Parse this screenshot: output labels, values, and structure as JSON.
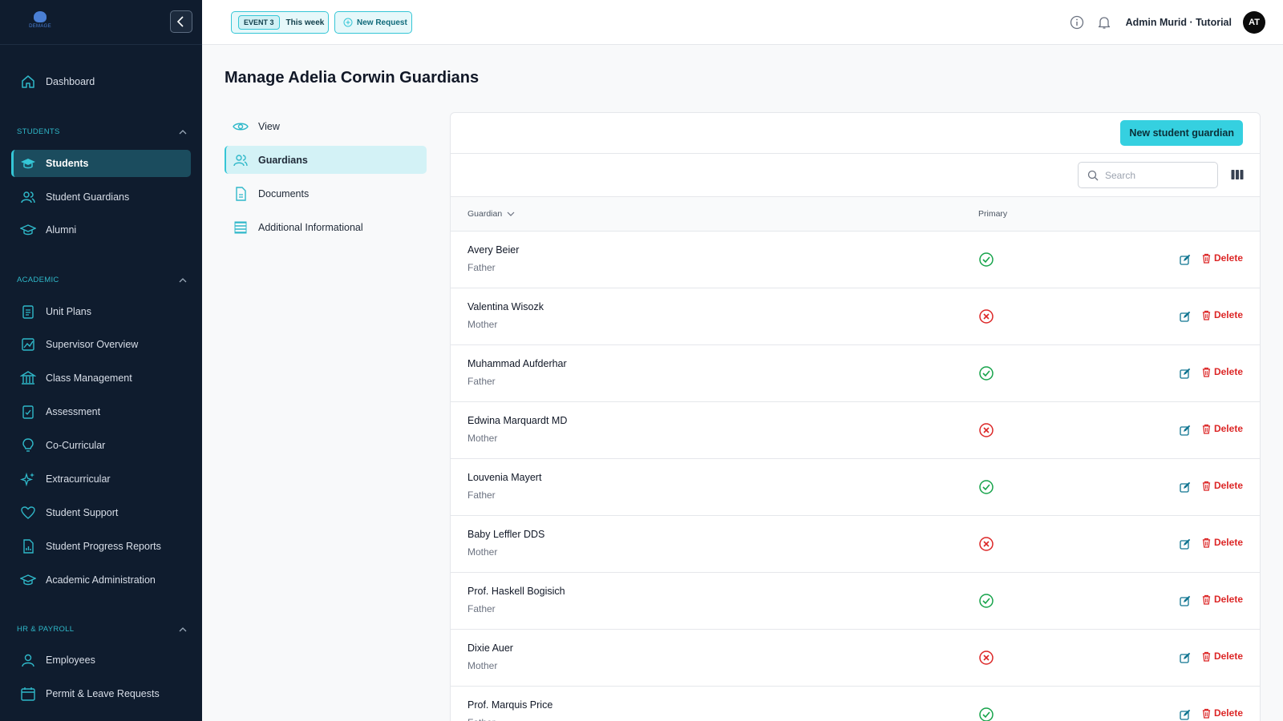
{
  "app": {
    "logo_text": "DEMAGE"
  },
  "sidebar": {
    "items_top": [
      {
        "label": "Dashboard",
        "icon": "home-icon"
      }
    ],
    "sections": [
      {
        "title": "STUDENTS",
        "items": [
          {
            "label": "Students",
            "icon": "graduation-cap-icon",
            "active": true
          },
          {
            "label": "Student Guardians",
            "icon": "users-icon"
          },
          {
            "label": "Alumni",
            "icon": "graduation-cap-icon"
          }
        ]
      },
      {
        "title": "ACADEMIC",
        "items": [
          {
            "label": "Unit Plans",
            "icon": "clipboard-list-icon"
          },
          {
            "label": "Supervisor Overview",
            "icon": "chart-icon"
          },
          {
            "label": "Class Management",
            "icon": "building-icon"
          },
          {
            "label": "Assessment",
            "icon": "clipboard-check-icon"
          },
          {
            "label": "Co-Curricular",
            "icon": "lightbulb-icon"
          },
          {
            "label": "Extracurricular",
            "icon": "sparkles-icon"
          },
          {
            "label": "Student Support",
            "icon": "heart-icon"
          },
          {
            "label": "Student Progress Reports",
            "icon": "report-icon"
          },
          {
            "label": "Academic Administration",
            "icon": "graduation-cap-icon"
          }
        ]
      },
      {
        "title": "HR & PAYROLL",
        "items": [
          {
            "label": "Employees",
            "icon": "user-icon"
          },
          {
            "label": "Permit & Leave Requests",
            "icon": "calendar-icon"
          }
        ]
      }
    ]
  },
  "topbar": {
    "event_badge": "EVENT 3",
    "event_label": "This week",
    "new_request": "New Request",
    "admin_label": "Admin Murid · Tutorial",
    "avatar_initials": "AT"
  },
  "page": {
    "title": "Manage Adelia Corwin Guardians",
    "subnav": [
      {
        "label": "View",
        "icon": "eye-icon"
      },
      {
        "label": "Guardians",
        "icon": "users-icon",
        "active": true
      },
      {
        "label": "Documents",
        "icon": "document-icon"
      },
      {
        "label": "Additional Informational",
        "icon": "list-icon"
      }
    ]
  },
  "table": {
    "new_button": "New student guardian",
    "search_placeholder": "Search",
    "columns": {
      "guardian": "Guardian",
      "primary": "Primary"
    },
    "delete_label": "Delete",
    "rows": [
      {
        "name": "Avery Beier",
        "relation": "Father",
        "primary": true
      },
      {
        "name": "Valentina Wisozk",
        "relation": "Mother",
        "primary": false
      },
      {
        "name": "Muhammad Aufderhar",
        "relation": "Father",
        "primary": true
      },
      {
        "name": "Edwina Marquardt MD",
        "relation": "Mother",
        "primary": false
      },
      {
        "name": "Louvenia Mayert",
        "relation": "Father",
        "primary": true
      },
      {
        "name": "Baby Leffler DDS",
        "relation": "Mother",
        "primary": false
      },
      {
        "name": "Prof. Haskell Bogisich",
        "relation": "Father",
        "primary": true
      },
      {
        "name": "Dixie Auer",
        "relation": "Mother",
        "primary": false
      },
      {
        "name": "Prof. Marquis Price",
        "relation": "Father",
        "primary": true
      }
    ]
  },
  "colors": {
    "sidebar_bg": "#0f1c2e",
    "accent": "#35c6d6",
    "success": "#16a34a",
    "danger": "#dc2626",
    "edit": "#0e7490"
  }
}
